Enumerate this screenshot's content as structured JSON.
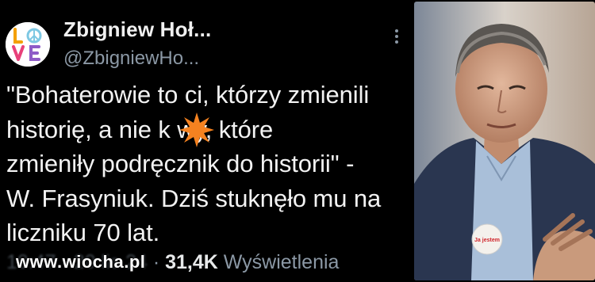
{
  "user": {
    "display_name": "Zbigniew Hoł...",
    "handle": "@ZbigniewHo...",
    "avatar_text": "LOVE"
  },
  "tweet": {
    "text": "\"Bohaterowie to ci, którzy zmienili\nhistorię, a nie k   wy, które\nzmieniły podręcznik do historii\" -\nW. Frasyniuk. Dziś stuknęło mu na\nliczniku 70 lat."
  },
  "meta": {
    "time_blurred": "10:47 · 20 lis 24",
    "separator": " · ",
    "views_count": "31,4K",
    "views_label": " Wyświetlenia"
  },
  "watermark": "www.wiocha.pl",
  "photo": {
    "badge_text": "Ja jestem"
  },
  "colors": {
    "background": "#000000",
    "text": "#e7e9ea",
    "secondary": "#8b98a5",
    "censor_star": "#f58220"
  },
  "icons": {
    "more": "more-vertical-icon",
    "censor": "star-burst-icon"
  }
}
